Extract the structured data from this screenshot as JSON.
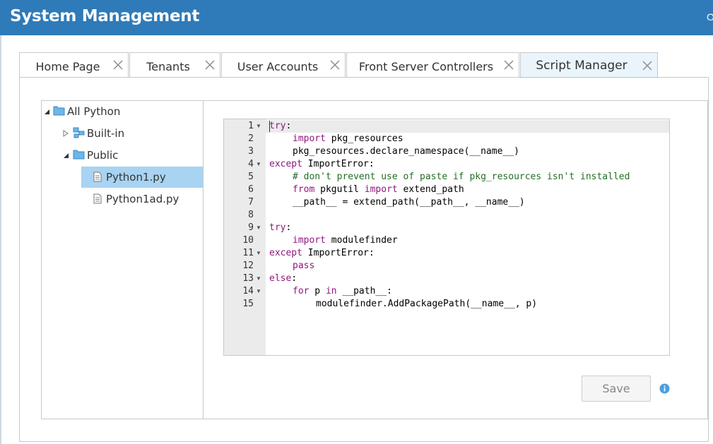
{
  "app": {
    "title": "System Management",
    "edge_text": "O"
  },
  "tabs": [
    {
      "label": "Home Page",
      "active": false
    },
    {
      "label": "Tenants",
      "active": false
    },
    {
      "label": "User Accounts",
      "active": false
    },
    {
      "label": "Front Server Controllers",
      "active": false
    },
    {
      "label": "Script Manager",
      "active": true
    }
  ],
  "tree": {
    "root": {
      "label": "All Python",
      "icon": "folder-icon",
      "expanded": true
    },
    "builtin": {
      "label": "Built-in",
      "icon": "folder-structure-icon",
      "expanded": false
    },
    "public": {
      "label": "Public",
      "icon": "folder-icon",
      "expanded": true
    },
    "files": [
      {
        "label": "Python1.py",
        "icon": "file-icon",
        "selected": true
      },
      {
        "label": "Python1ad.py",
        "icon": "file-icon",
        "selected": false
      }
    ]
  },
  "editor": {
    "lines": [
      {
        "n": "1",
        "fold": true
      },
      {
        "n": "2",
        "fold": false
      },
      {
        "n": "3",
        "fold": false
      },
      {
        "n": "4",
        "fold": true
      },
      {
        "n": "5",
        "fold": false
      },
      {
        "n": "6",
        "fold": false
      },
      {
        "n": "7",
        "fold": false
      },
      {
        "n": "8",
        "fold": false
      },
      {
        "n": "9",
        "fold": true
      },
      {
        "n": "10",
        "fold": false
      },
      {
        "n": "11",
        "fold": true
      },
      {
        "n": "12",
        "fold": false
      },
      {
        "n": "13",
        "fold": true
      },
      {
        "n": "14",
        "fold": true
      },
      {
        "n": "15",
        "fold": false
      }
    ],
    "code": {
      "l1_kw": "try",
      "l1_rest": ":",
      "l2_kw": "import",
      "l2_rest": " pkg_resources",
      "l3": "pkg_resources.declare_namespace(__name__)",
      "l4_kw": "except",
      "l4_rest": " ImportError:",
      "l5_comment": "# don't prevent use of paste if pkg_resources isn't installed",
      "l6_kw1": "from",
      "l6_mid": " pkgutil ",
      "l6_kw2": "import",
      "l6_rest": " extend_path",
      "l7": "__path__ = extend_path(__path__, __name__)",
      "l9_kw": "try",
      "l9_rest": ":",
      "l10_kw": "import",
      "l10_rest": " modulefinder",
      "l11_kw": "except",
      "l11_rest": " ImportError:",
      "l12_kw": "pass",
      "l13_kw": "else",
      "l13_rest": ":",
      "l14_kw1": "for",
      "l14_mid": " p ",
      "l14_kw2": "in",
      "l14_rest": " __path__:",
      "l15": "modulefinder.AddPackagePath(__name__, p)"
    }
  },
  "actions": {
    "save_label": "Save",
    "info_icon": "info-icon"
  },
  "colors": {
    "header": "#2f7ab8",
    "selected_row": "#a9d3f2",
    "keyword": "#93157f",
    "comment": "#236e24",
    "active_tab": "#eaf4fb"
  }
}
